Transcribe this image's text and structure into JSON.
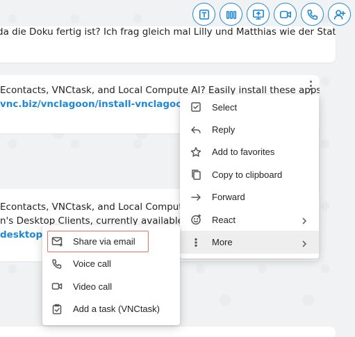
{
  "toolbar": {
    "buttons": [
      {
        "name": "text-icon"
      },
      {
        "name": "bar-chart-icon"
      },
      {
        "name": "screen-share-icon"
      },
      {
        "name": "video-camera-icon"
      },
      {
        "name": "phone-icon"
      },
      {
        "name": "add-user-icon"
      }
    ]
  },
  "messages": [
    {
      "text": "da die Doku fertig ist? Ich frag gleich mal Lilly und Matthias wie der Status ist."
    },
    {
      "line1": "Econtacts, VNCtask, and Local Compute AI? Easily install these apps on",
      "link": "vnc.biz/vnclagoon/install-vnclagoon-desk"
    },
    {
      "line1": "Econtacts, VNCtask, and Local Compute AI? I",
      "line2": "n's Desktop Clients, currently available with",
      "link": "desktop-c"
    }
  ],
  "main_menu": {
    "items": [
      {
        "label": "Select",
        "icon": "checkbox-icon"
      },
      {
        "label": "Reply",
        "icon": "reply-icon"
      },
      {
        "label": "Add to favorites",
        "icon": "star-icon"
      },
      {
        "label": "Copy to clipboard",
        "icon": "copy-icon"
      },
      {
        "label": "Forward",
        "icon": "arrow-right-icon"
      },
      {
        "label": "React",
        "icon": "smiley-icon"
      },
      {
        "label": "More",
        "icon": "dots-vertical-icon"
      }
    ]
  },
  "sub_menu": {
    "items": [
      {
        "label": "Share via email",
        "icon": "email-share-icon"
      },
      {
        "label": "Voice call",
        "icon": "phone-icon"
      },
      {
        "label": "Video call",
        "icon": "video-camera-icon"
      },
      {
        "label": "Add a task (VNCtask)",
        "icon": "task-check-icon"
      }
    ]
  },
  "colors": {
    "accent": "#1f88d3",
    "highlight_border": "#e8735a"
  }
}
